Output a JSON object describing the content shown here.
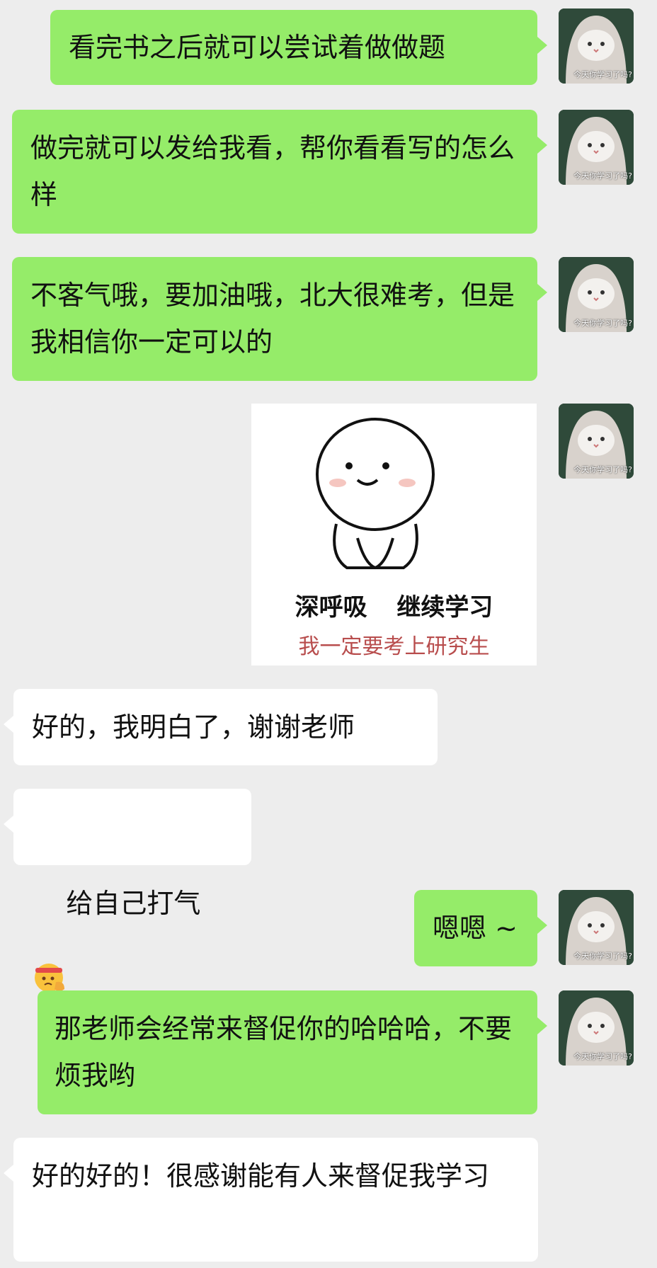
{
  "messages": [
    {
      "side": "out",
      "text": "看完书之后就可以尝试着做做题"
    },
    {
      "side": "out",
      "text": "做完就可以发给我看，帮你看看写的怎么样"
    },
    {
      "side": "out",
      "text": "不客气哦，要加油哦，北大很难考，但是我相信你一定可以的"
    },
    {
      "side": "out",
      "type": "sticker",
      "line1": "深呼吸 继续学习",
      "line2": "我一定要考上研究生"
    },
    {
      "side": "in",
      "text": "好的，我明白了，谢谢老师"
    },
    {
      "side": "in",
      "text": "给自己打气",
      "emoji": "saluting-face-with-headband-emoji"
    },
    {
      "side": "out",
      "text": "嗯嗯 ~"
    },
    {
      "side": "out",
      "text": "那老师会经常来督促你的哈哈哈，不要烦我哟"
    },
    {
      "side": "in",
      "text": "好的好的！很感谢能有人来督促我学习"
    }
  ],
  "avatar": {
    "caption": "今天你学习了吗?",
    "icon": "cat-avatar-icon"
  },
  "colors": {
    "background": "#ededed",
    "outgoing_bubble": "#95ec69",
    "incoming_bubble": "#ffffff"
  }
}
